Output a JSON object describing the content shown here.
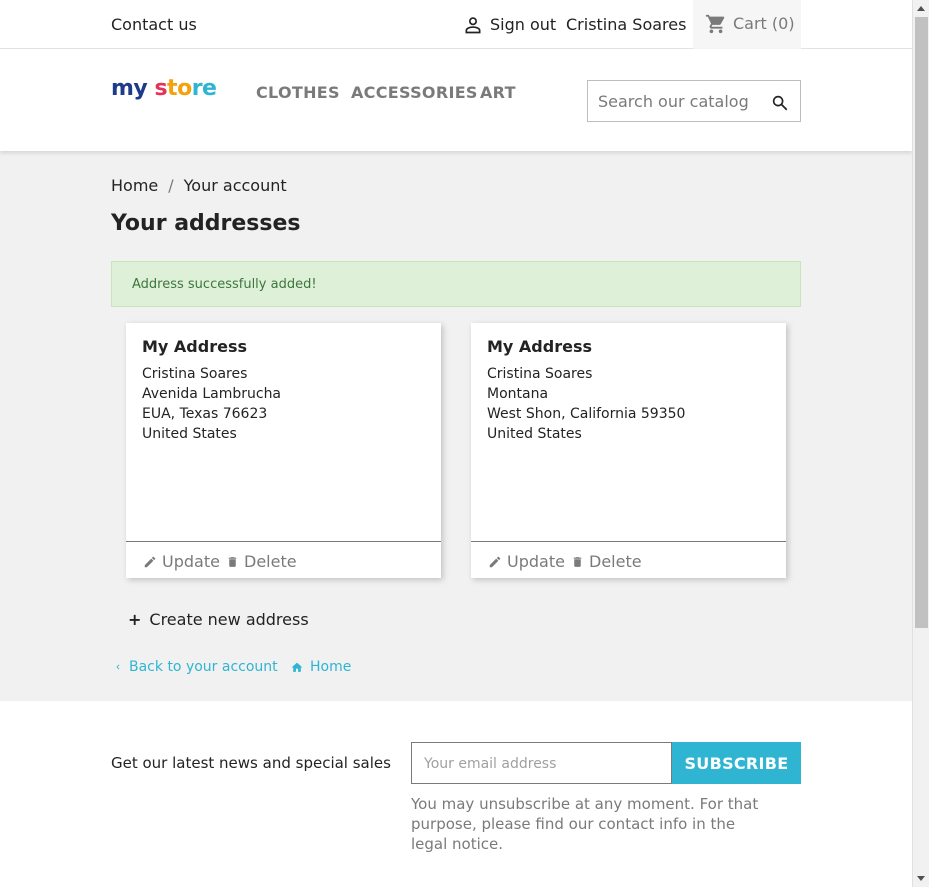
{
  "topbar": {
    "contact": "Contact us",
    "signout": "Sign out",
    "username": "Cristina Soares",
    "cart": "Cart (0)"
  },
  "header": {
    "logo": {
      "my": "my",
      "s": "s",
      "to": "to",
      "re": "re"
    },
    "nav": [
      "CLOTHES",
      "ACCESSORIES",
      "ART"
    ],
    "search_placeholder": "Search our catalog"
  },
  "breadcrumb": {
    "home": "Home",
    "separator": "/",
    "current": "Your account"
  },
  "page_title": "Your addresses",
  "alert": "Address successfully added!",
  "addresses": [
    {
      "title": "My Address",
      "lines": [
        "Cristina Soares",
        "Avenida Lambrucha",
        "EUA, Texas 76623",
        "United States"
      ],
      "update": "Update",
      "delete": "Delete"
    },
    {
      "title": "My Address",
      "lines": [
        "Cristina Soares",
        "Montana",
        "West Shon, California 59350",
        "United States"
      ],
      "update": "Update",
      "delete": "Delete"
    }
  ],
  "create_address": {
    "plus": "+",
    "label": "Create new address"
  },
  "links": {
    "back": "Back to your account",
    "home": "Home"
  },
  "newsletter": {
    "pitch": "Get our latest news and special sales",
    "email_placeholder": "Your email address",
    "subscribe": "SUBSCRIBE",
    "note": "You may unsubscribe at any moment. For that purpose, please find our contact info in the legal notice."
  },
  "colors": {
    "accent": "#2fb5d2",
    "alert_bg": "#dff0d8",
    "alert_text": "#3c763d"
  }
}
